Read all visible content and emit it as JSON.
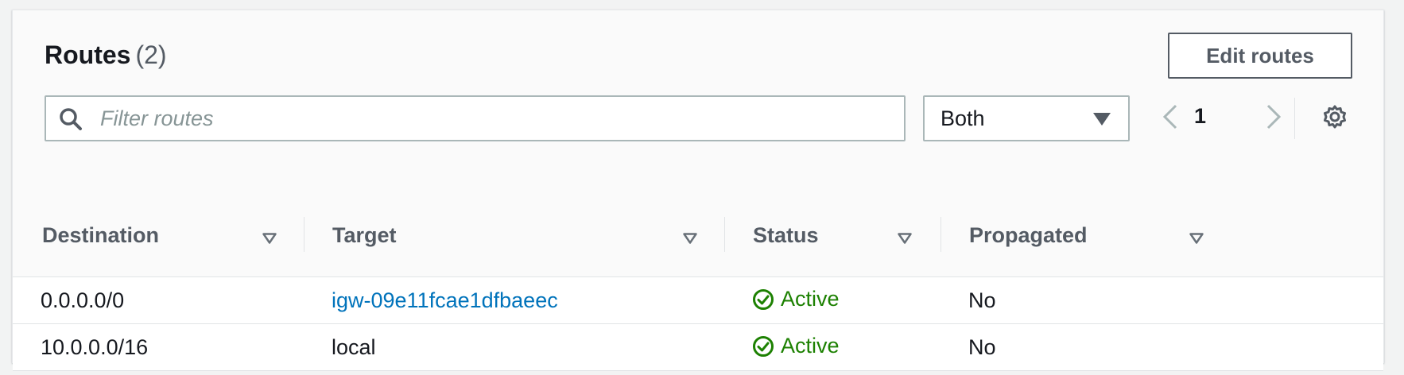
{
  "header": {
    "title": "Routes",
    "count": "(2)",
    "edit_label": "Edit routes"
  },
  "filter": {
    "placeholder": "Filter routes",
    "select_value": "Both"
  },
  "pagination": {
    "current_page": "1"
  },
  "table": {
    "columns": [
      "Destination",
      "Target",
      "Status",
      "Propagated"
    ],
    "rows": [
      {
        "destination": "0.0.0.0/0",
        "target": "igw-09e11fcae1dfbaeec",
        "status": "Active",
        "propagated": "No"
      },
      {
        "destination": "10.0.0.0/16",
        "target": "local",
        "status": "Active",
        "propagated": "No"
      }
    ]
  },
  "colors": {
    "link": "#0073bb",
    "success": "#1d8102",
    "border": "#aab7b8"
  },
  "icons": {
    "search": "search-icon",
    "dropdown": "caret-down-icon",
    "prev": "chevron-left-icon",
    "next": "chevron-right-icon",
    "settings": "gear-icon",
    "sort": "sort-triangle-icon",
    "status": "check-circle-icon"
  }
}
